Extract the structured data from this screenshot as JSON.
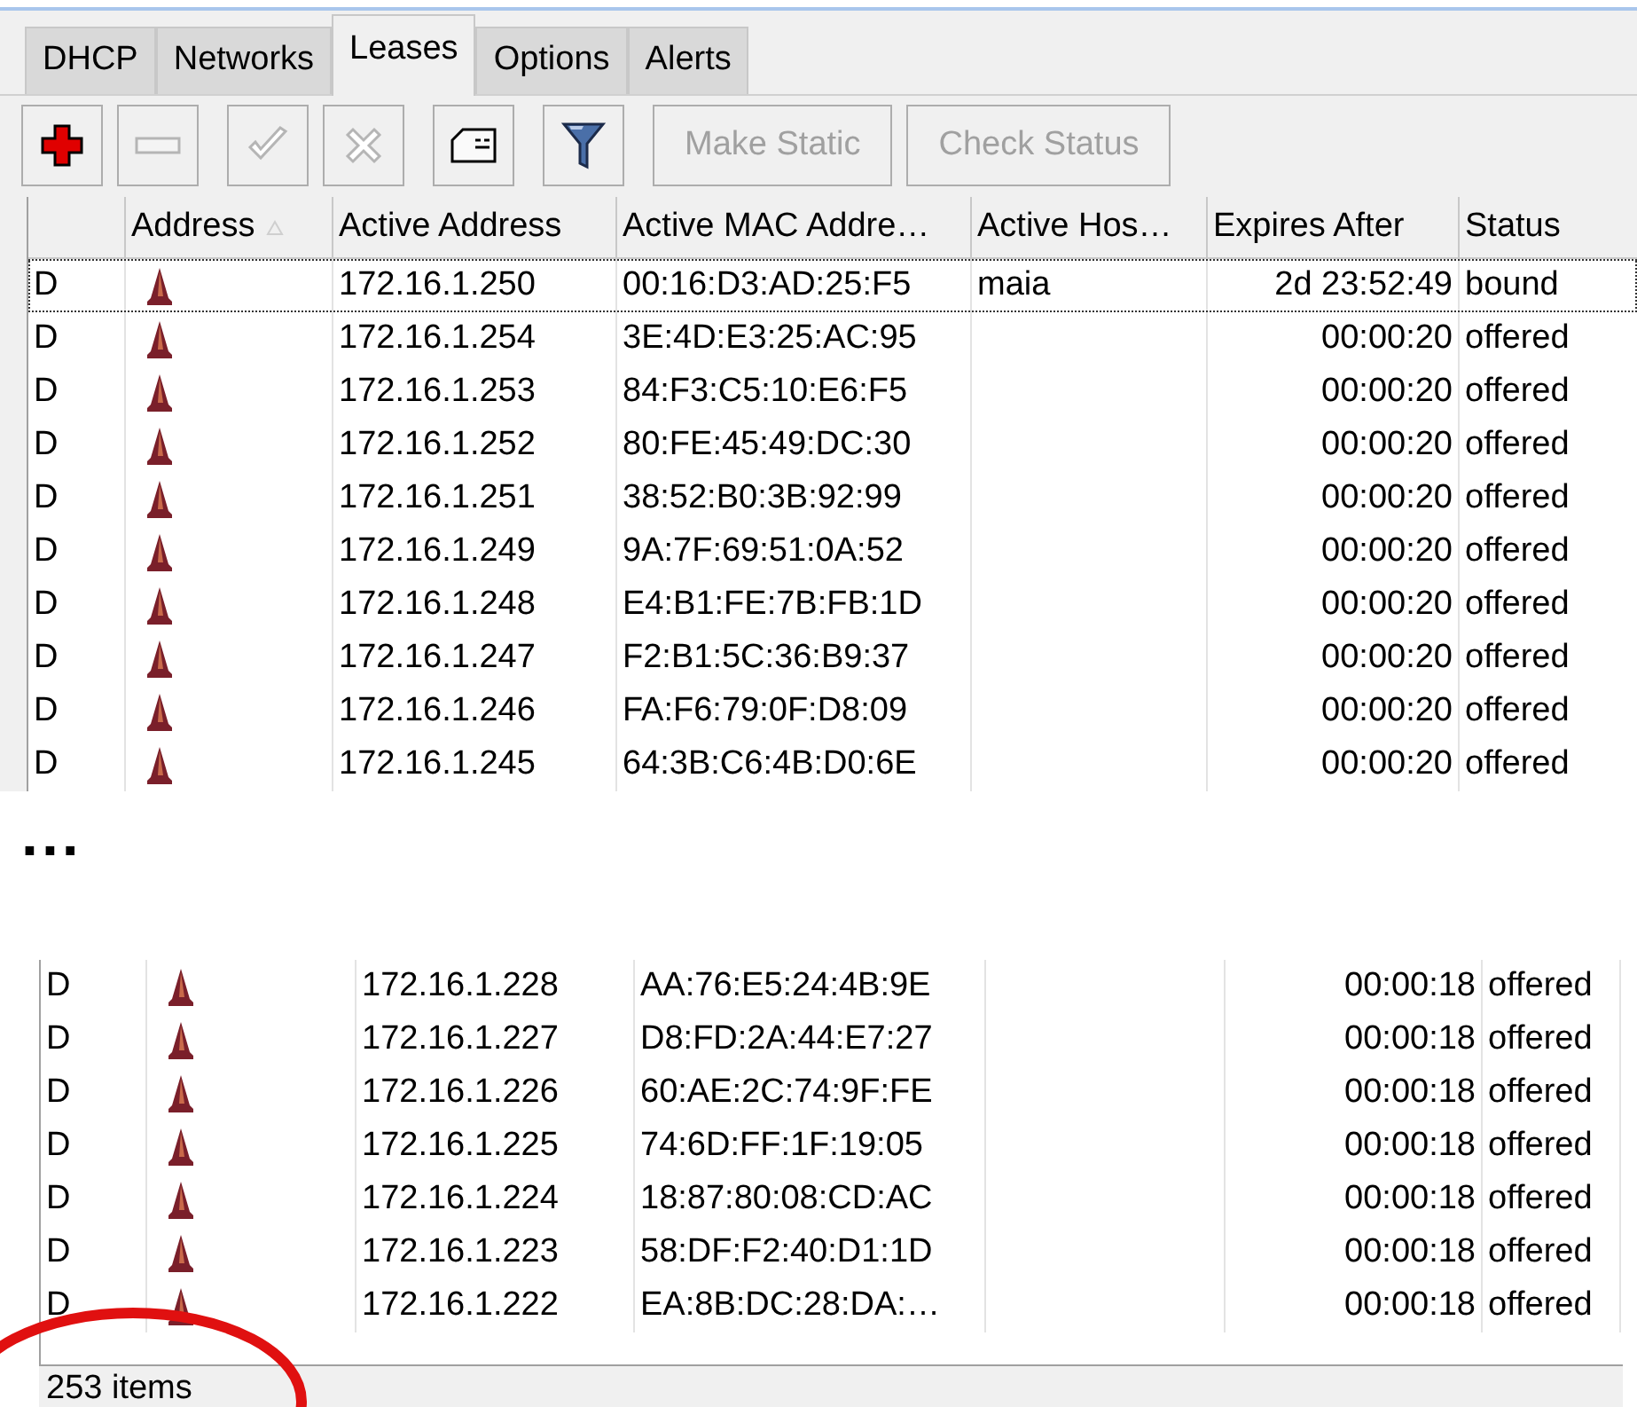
{
  "tabs": [
    {
      "label": "DHCP",
      "selected": false
    },
    {
      "label": "Networks",
      "selected": false
    },
    {
      "label": "Leases",
      "selected": true
    },
    {
      "label": "Options",
      "selected": false
    },
    {
      "label": "Alerts",
      "selected": false
    }
  ],
  "toolbar": [
    {
      "kind": "add",
      "disabled": false
    },
    {
      "kind": "remove",
      "disabled": true
    },
    {
      "kind": "enable",
      "disabled": true
    },
    {
      "kind": "disable",
      "disabled": true
    },
    {
      "kind": "comment",
      "disabled": false
    },
    {
      "kind": "filter",
      "disabled": false
    },
    {
      "kind": "text",
      "label": "Make Static",
      "disabled": true
    },
    {
      "kind": "text",
      "label": "Check Status",
      "disabled": true
    }
  ],
  "table": {
    "columns": [
      {
        "sorted": false
      },
      {
        "label": "Address",
        "sorted": true
      },
      {
        "label": "Active Address",
        "sorted": false
      },
      {
        "label": "Active MAC Addre…",
        "sorted": false
      },
      {
        "label": "Active Hos…",
        "sorted": false
      },
      {
        "label": "Expires After",
        "sorted": false
      },
      {
        "label": "Status",
        "sorted": false
      }
    ],
    "rows": [
      {
        "flag": "D",
        "active_address": "172.16.1.250",
        "mac": "00:16:D3:AD:25:F5",
        "host": "maia",
        "expires": "2d 23:52:49",
        "status": "bound",
        "focused": true
      },
      {
        "flag": "D",
        "active_address": "172.16.1.254",
        "mac": "3E:4D:E3:25:AC:95",
        "expires": "00:00:20",
        "status": "offered",
        "focused": false
      },
      {
        "flag": "D",
        "active_address": "172.16.1.253",
        "mac": "84:F3:C5:10:E6:F5",
        "expires": "00:00:20",
        "status": "offered",
        "focused": false
      },
      {
        "flag": "D",
        "active_address": "172.16.1.252",
        "mac": "80:FE:45:49:DC:30",
        "expires": "00:00:20",
        "status": "offered",
        "focused": false
      },
      {
        "flag": "D",
        "active_address": "172.16.1.251",
        "mac": "38:52:B0:3B:92:99",
        "expires": "00:00:20",
        "status": "offered",
        "focused": false
      },
      {
        "flag": "D",
        "active_address": "172.16.1.249",
        "mac": "9A:7F:69:51:0A:52",
        "expires": "00:00:20",
        "status": "offered",
        "focused": false
      },
      {
        "flag": "D",
        "active_address": "172.16.1.248",
        "mac": "E4:B1:FE:7B:FB:1D",
        "expires": "00:00:20",
        "status": "offered",
        "focused": false
      },
      {
        "flag": "D",
        "active_address": "172.16.1.247",
        "mac": "F2:B1:5C:36:B9:37",
        "expires": "00:00:20",
        "status": "offered",
        "focused": false
      },
      {
        "flag": "D",
        "active_address": "172.16.1.246",
        "mac": "FA:F6:79:0F:D8:09",
        "expires": "00:00:20",
        "status": "offered",
        "focused": false
      },
      {
        "flag": "D",
        "active_address": "172.16.1.245",
        "mac": "64:3B:C6:4B:D0:6E",
        "expires": "00:00:20",
        "status": "offered",
        "focused": false
      }
    ]
  },
  "gap_marker": "...",
  "bottom_table": {
    "rows": [
      {
        "flag": "D",
        "active_address": "172.16.1.228",
        "mac": "AA:76:E5:24:4B:9E",
        "expires": "00:00:18",
        "status": "offered",
        "focused": false
      },
      {
        "flag": "D",
        "active_address": "172.16.1.227",
        "mac": "D8:FD:2A:44:E7:27",
        "expires": "00:00:18",
        "status": "offered",
        "focused": false
      },
      {
        "flag": "D",
        "active_address": "172.16.1.226",
        "mac": "60:AE:2C:74:9F:FE",
        "expires": "00:00:18",
        "status": "offered",
        "focused": false
      },
      {
        "flag": "D",
        "active_address": "172.16.1.225",
        "mac": "74:6D:FF:1F:19:05",
        "expires": "00:00:18",
        "status": "offered",
        "focused": false
      },
      {
        "flag": "D",
        "active_address": "172.16.1.224",
        "mac": "18:87:80:08:CD:AC",
        "expires": "00:00:18",
        "status": "offered",
        "focused": false
      },
      {
        "flag": "D",
        "active_address": "172.16.1.223",
        "mac": "58:DF:F2:40:D1:1D",
        "expires": "00:00:18",
        "status": "offered",
        "focused": false
      },
      {
        "flag": "D",
        "active_address": "172.16.1.222",
        "mac": "EA:8B:DC:28:DA:…",
        "expires": "00:00:18",
        "status": "offered",
        "focused": false
      }
    ],
    "status_bar": "253 items"
  }
}
